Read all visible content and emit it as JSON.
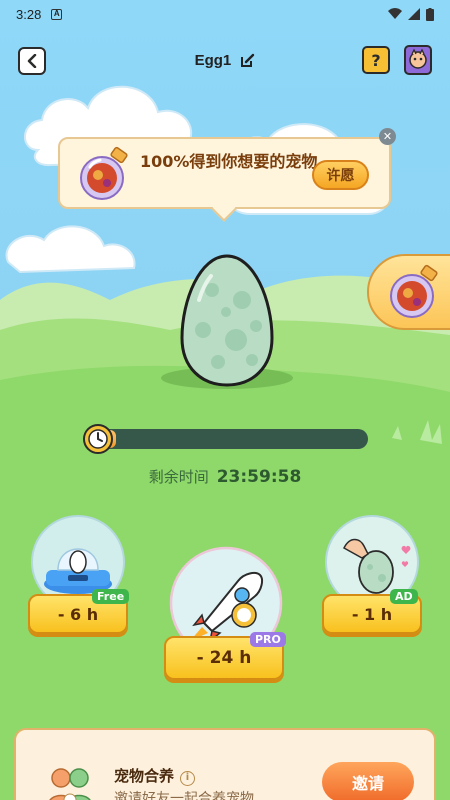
{
  "statusbar": {
    "time": "3:28"
  },
  "header": {
    "title": "Egg1"
  },
  "wish_popup": {
    "text": "100%得到你想要的宠物",
    "button": "许愿"
  },
  "incubation": {
    "progress": 0.03,
    "remaining_label": "剩余时间",
    "remaining_value": "23:59:58"
  },
  "boosts": [
    {
      "label": "- 6 h",
      "tag": "Free"
    },
    {
      "label": "- 24 h",
      "tag": "PRO"
    },
    {
      "label": "- 1 h",
      "tag": "AD"
    }
  ],
  "co_raise": {
    "title": "宠物合养",
    "description": "邀请好友一起合养宠物",
    "button": "邀请"
  },
  "colors": {
    "sky": "#8fd8f8",
    "grass": "#8fd86a",
    "accent_orange": "#f5a623",
    "free_tag": "#3fb64b",
    "pro_tag": "#9b7ae8",
    "ad_tag": "#3fb64b"
  }
}
